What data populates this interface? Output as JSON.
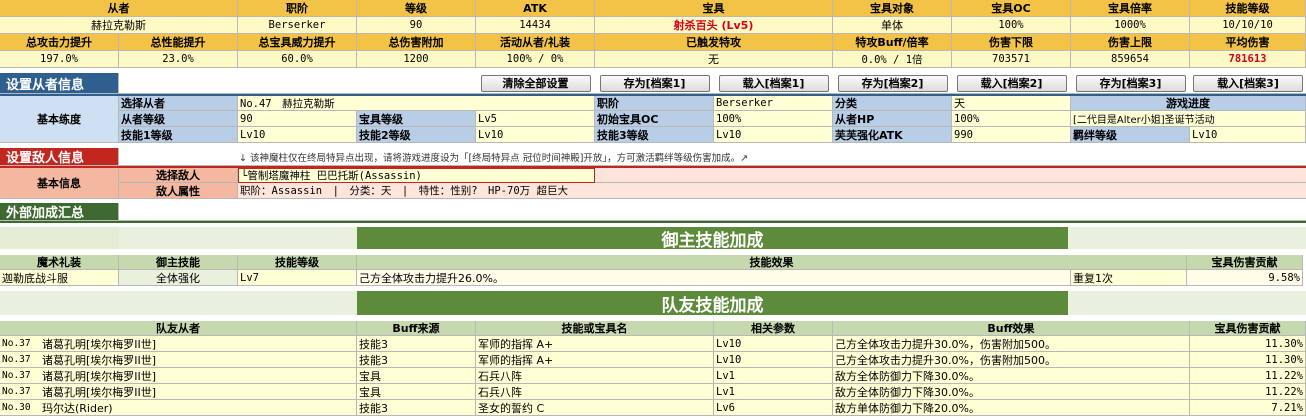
{
  "summary": {
    "headers1": [
      "从者",
      "职阶",
      "等级",
      "ATK",
      "宝具",
      "宝具对象",
      "宝具OC",
      "宝具倍率",
      "技能等级"
    ],
    "values1": [
      "赫拉克勒斯",
      "Berserker",
      "90",
      "14434",
      "射杀百头 (Lv5)",
      "单体",
      "100%",
      "1000%",
      "10/10/10"
    ],
    "headers2": [
      "总攻击力提升",
      "总性能提升",
      "总宝具威力提升",
      "总伤害附加",
      "活动从者/礼装",
      "已触发特攻",
      "特攻Buff/倍率",
      "伤害下限",
      "伤害上限",
      "平均伤害"
    ],
    "values2": [
      "197.0%",
      "23.0%",
      "60.0%",
      "1200",
      "100% / 0%",
      "无",
      "0.0% / 1倍",
      "703571",
      "859654",
      "781613"
    ]
  },
  "servant_section": {
    "title": "设置从者信息",
    "buttons": [
      "清除全部设置",
      "存为[档案1]",
      "载入[档案1]",
      "存为[档案2]",
      "载入[档案2]",
      "存为[档案3]",
      "载入[档案3]"
    ],
    "group_label": "基本练度",
    "select_label": "选择从者",
    "select_value": "No.47　赫拉克勒斯",
    "class_label": "职阶",
    "class_value": "Berserker",
    "category_label": "分类",
    "category_value": "天",
    "progress_label": "游戏进度",
    "level_label": "从者等级",
    "level_value": "90",
    "np_level_label": "宝具等级",
    "np_level_value": "Lv5",
    "oc_label": "初始宝具OC",
    "oc_value": "100%",
    "hp_label": "从者HP",
    "hp_value": "100%",
    "progress_value": "[二代目是Alter小姐]圣诞节活动",
    "skill1_label": "技能1等级",
    "skill1_value": "Lv10",
    "skill2_label": "技能2等级",
    "skill2_value": "Lv10",
    "skill3_label": "技能3等级",
    "skill3_value": "Lv10",
    "fou_label": "芙芙强化ATK",
    "fou_value": "990",
    "bond_label": "羁绊等级",
    "bond_value": "Lv10"
  },
  "enemy_section": {
    "title": "设置敌人信息",
    "note": "↓ 该神魔柱仅在终局特异点出现，请将游戏进度设为「[终局特异点 冠位时间神殿]开放」，方可激活羁绊等级伤害加成。↗",
    "group_label": "基本信息",
    "select_label": "选择敌人",
    "select_value": "└管制塔魔神柱 巴巴托斯(Assassin)",
    "attr_label": "敌人属性",
    "attr_value": "职阶：Assassin　|　分类：天　|　特性：性别?　HP-70万 超巨大"
  },
  "external": {
    "title": "外部加成汇总",
    "master_title": "御主技能加成",
    "master_headers": [
      "魔术礼装",
      "御主技能",
      "技能等级",
      "技能效果",
      "宝具伤害贡献"
    ],
    "master_row": [
      "迦勒底战斗服",
      "全体强化",
      "Lv7",
      "己方全体攻击力提升26.0%。",
      "重复1次",
      "9.58%"
    ],
    "ally_title": "队友技能加成",
    "ally_headers": [
      "队友从者",
      "Buff来源",
      "技能或宝具名",
      "相关参数",
      "Buff效果",
      "宝具伤害贡献"
    ],
    "ally_rows": [
      [
        "No.37",
        "诸葛孔明[埃尔梅罗II世]",
        "技能3",
        "军师的指挥 A+",
        "Lv10",
        "己方全体攻击力提升30.0%，伤害附加500。",
        "11.30%"
      ],
      [
        "No.37",
        "诸葛孔明[埃尔梅罗II世]",
        "技能3",
        "军师的指挥 A+",
        "Lv10",
        "己方全体攻击力提升30.0%，伤害附加500。",
        "11.30%"
      ],
      [
        "No.37",
        "诸葛孔明[埃尔梅罗II世]",
        "宝具",
        "石兵八阵",
        "Lv1",
        "敌方全体防御力下降30.0%。",
        "11.22%"
      ],
      [
        "No.37",
        "诸葛孔明[埃尔梅罗II世]",
        "宝具",
        "石兵八阵",
        "Lv1",
        "敌方全体防御力下降30.0%。",
        "11.22%"
      ],
      [
        "No.30",
        "玛尔达(Rider)",
        "技能3",
        "圣女的誓约 C",
        "Lv6",
        "敌方单体防御力下降20.0%。",
        "7.21%"
      ]
    ]
  }
}
